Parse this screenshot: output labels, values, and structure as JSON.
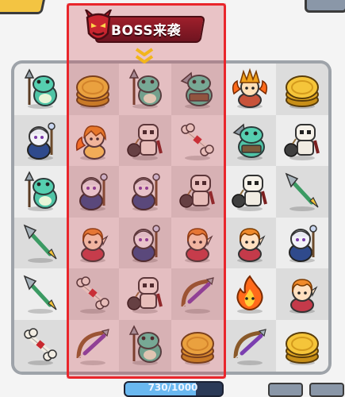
{
  "banner": {
    "text": "BOSS来袭"
  },
  "hp": {
    "text": "730/1000",
    "fraction": 0.73
  },
  "colors": {
    "highlight_border": "#e9252b",
    "banner": "#9e1f2b"
  },
  "grid": {
    "rows": 6,
    "cols": 6,
    "highlight_cols": [
      1,
      2,
      3
    ],
    "cells": [
      [
        "frog-spear",
        "gold-coin",
        "frog-spear",
        "frog-mech",
        "fire-chief",
        "gold-coin"
      ],
      [
        "mage-white",
        "fire-girl",
        "skeleton-bomb",
        "bone",
        "frog-mech",
        "skeleton-bomb"
      ],
      [
        "frog-spear",
        "mage-white",
        "mage-white",
        "skeleton-bomb",
        "skeleton-bomb",
        "spear-tip"
      ],
      [
        "spear-tip",
        "elf-girl",
        "mage-white",
        "elf-girl",
        "elf-girl",
        "mage-white"
      ],
      [
        "spear-tip",
        "bone",
        "skeleton-bomb",
        "crossbow",
        "fire-spirit",
        "elf-girl"
      ],
      [
        "bone",
        "crossbow",
        "frog-spear",
        "gold-coin",
        "crossbow",
        "gold-coin"
      ]
    ]
  }
}
